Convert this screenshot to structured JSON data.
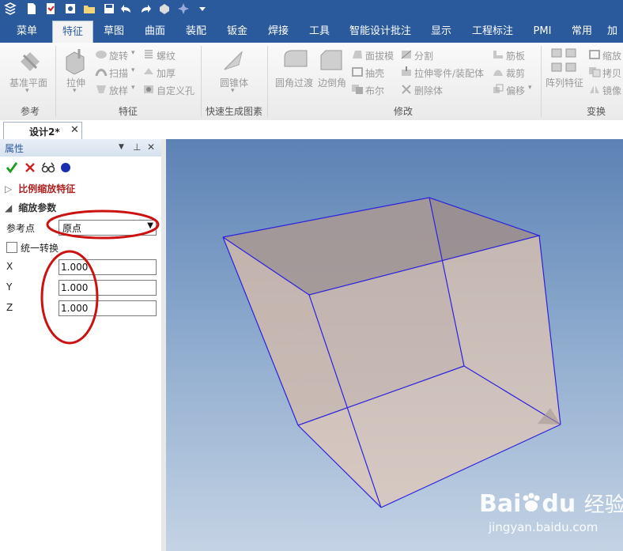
{
  "ribbon_tabs": [
    "菜单",
    "特征",
    "草图",
    "曲面",
    "装配",
    "钣金",
    "焊接",
    "工具",
    "智能设计批注",
    "显示",
    "工程标注",
    "PMI",
    "常用",
    "加"
  ],
  "active_tab": "特征",
  "ribbon": {
    "ref_plane": "基准平面",
    "extrude": "拉伸",
    "revolve": "旋转",
    "sweep": "扫描",
    "loft": "放样",
    "thread": "螺纹",
    "thicken": "加厚",
    "custom_hole": "自定义孔",
    "cone": "圆锥体",
    "fillet": "圆角过渡",
    "chamfer": "边倒角",
    "face_draft": "面拔模",
    "shell": "抽壳",
    "boolean": "布尔",
    "split": "分割",
    "extrude_to_part": "拉伸零件/装配体",
    "delete_body": "删除体",
    "rib": "筋板",
    "trim": "裁剪",
    "offset": "偏移",
    "array": "阵列特征",
    "scale": "缩放",
    "copy": "拷贝",
    "mirror": "镜像"
  },
  "ribbon_groups": {
    "reference": "参考",
    "feature": "特征",
    "quick_shapes": "快速生成图素",
    "modify": "修改",
    "transform": "变换"
  },
  "document_tab": "设计2*",
  "panel": {
    "title": "属性",
    "feature_section": "比例缩放特征",
    "params_section": "缩放参数",
    "ref_point_label": "参考点",
    "ref_point_value": "原点",
    "uniform_label": "统一转换",
    "x_label": "X",
    "x_value": "1.000",
    "y_label": "Y",
    "y_value": "1.000",
    "z_label": "Z",
    "z_value": "1.000"
  },
  "watermark": {
    "brand": "Bai",
    "brand_tail": "du",
    "cn": "经验",
    "url": "jingyan.baidu.com"
  },
  "colors": {
    "ribbon_blue": "#2a5a9c",
    "accept_green": "#1aa01a",
    "cancel_red": "#cc2222",
    "annotation_red": "#cc1111",
    "model_fill": "#c8b4a8",
    "edge_blue": "#2a22dd"
  }
}
